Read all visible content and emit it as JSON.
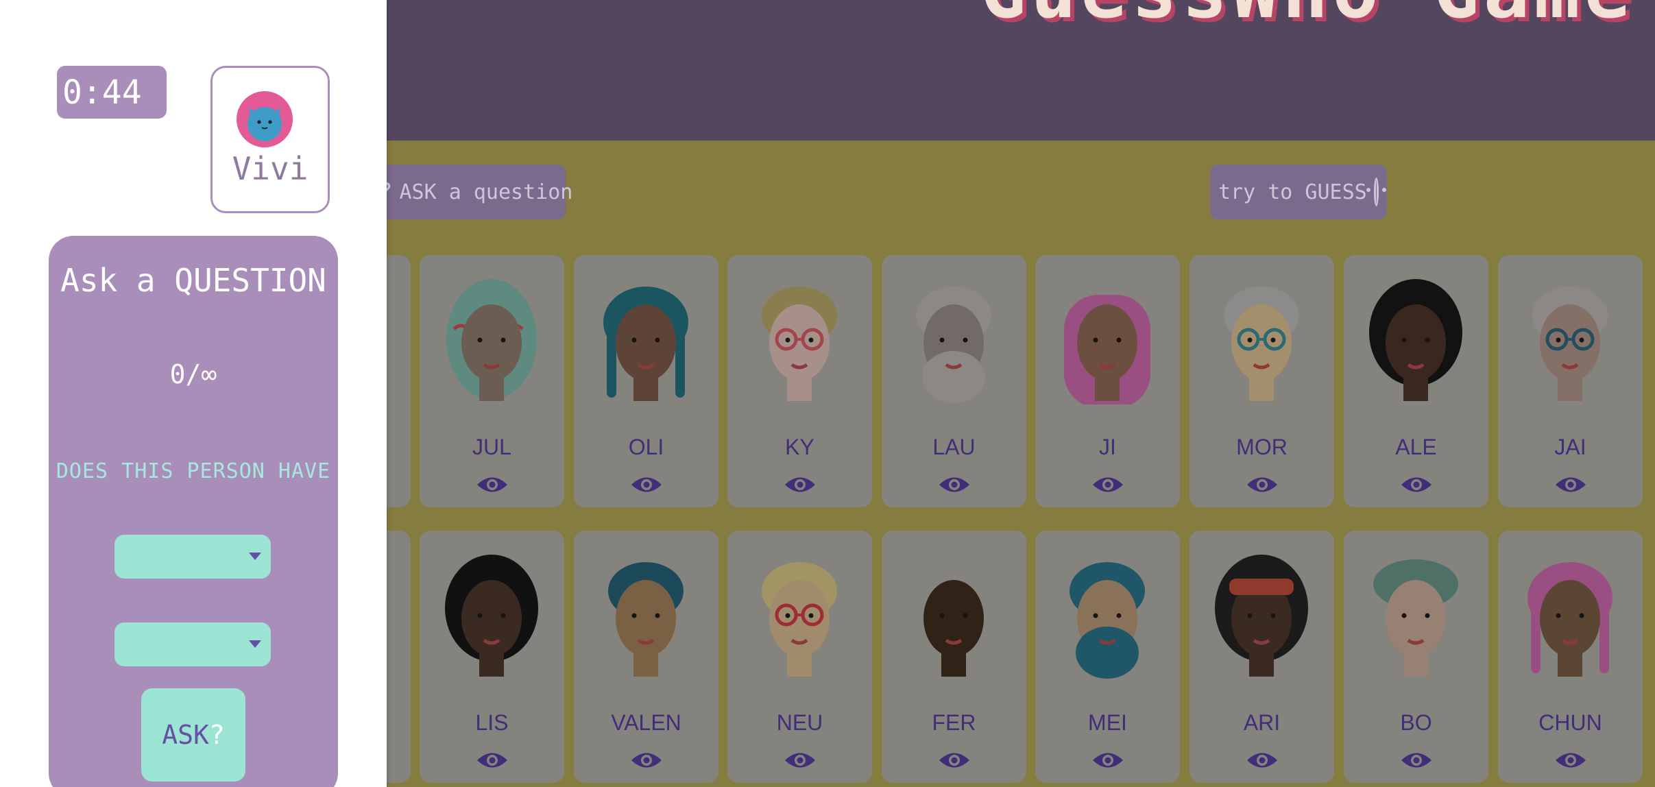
{
  "game": {
    "title": "GuessWho Game",
    "ask_button_label": "ASK a question",
    "guess_button_label": "try to GUESS",
    "row1": [
      {
        "name": "JUL"
      },
      {
        "name": "OLI"
      },
      {
        "name": "KY"
      },
      {
        "name": "LAU"
      },
      {
        "name": "JI"
      },
      {
        "name": "MOR"
      },
      {
        "name": "ALE"
      },
      {
        "name": "JAI"
      }
    ],
    "row2": [
      {
        "name": "LIS"
      },
      {
        "name": "VALEN"
      },
      {
        "name": "NEU"
      },
      {
        "name": "FER"
      },
      {
        "name": "MEI"
      },
      {
        "name": "ARI"
      },
      {
        "name": "BO"
      },
      {
        "name": "CHUN"
      }
    ]
  },
  "sidebar": {
    "timer": "0:44",
    "player_name": "Vivi",
    "question_panel": {
      "title": "Ask a QUESTION",
      "count": "0/∞",
      "prompt": "DOES THIS PERSON HAVE",
      "dropdown1_value": "",
      "dropdown2_value": "",
      "ask_label": "ASK",
      "ask_suffix": "?"
    }
  },
  "colors": {
    "accent_purple": "#a98eba",
    "mint": "#9ce4d3",
    "card_name": "#3f2f78",
    "board_yellow_dimmed": "#857d40",
    "header_dimmed": "#54465f"
  },
  "icons": {
    "card_view": "eye-icon",
    "guess": "smiley-icon",
    "ask": "question-icon"
  }
}
